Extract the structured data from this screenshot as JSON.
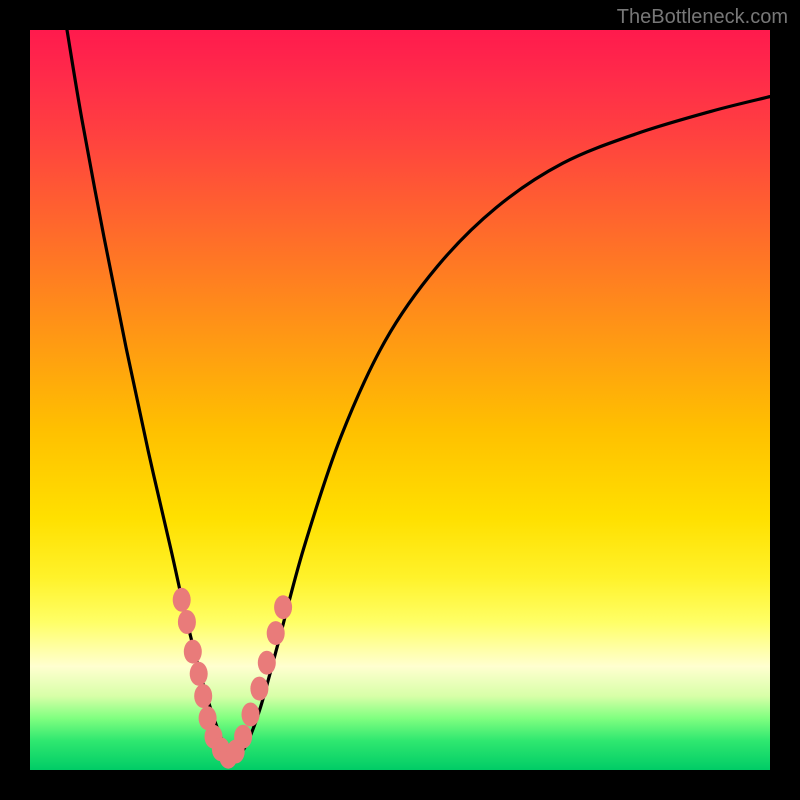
{
  "watermark": "TheBottleneck.com",
  "chart_data": {
    "type": "line",
    "title": "",
    "xlabel": "",
    "ylabel": "",
    "xlim": [
      0,
      100
    ],
    "ylim": [
      0,
      100
    ],
    "series": [
      {
        "name": "bottleneck-curve",
        "x": [
          5,
          7,
          10,
          13,
          16,
          19,
          21,
          23,
          24.5,
          26,
          27.5,
          29,
          31,
          33.5,
          37,
          42,
          48,
          55,
          63,
          72,
          82,
          92,
          100
        ],
        "y": [
          100,
          88,
          72,
          57,
          43,
          30,
          21,
          13,
          8,
          4,
          2,
          3,
          8,
          17,
          30,
          45,
          58,
          68,
          76,
          82,
          86,
          89,
          91
        ]
      }
    ],
    "markers": {
      "name": "highlighted-points",
      "color": "#e97b7a",
      "points": [
        {
          "x": 20.5,
          "y": 23
        },
        {
          "x": 21.2,
          "y": 20
        },
        {
          "x": 22.0,
          "y": 16
        },
        {
          "x": 22.8,
          "y": 13
        },
        {
          "x": 23.4,
          "y": 10
        },
        {
          "x": 24.0,
          "y": 7
        },
        {
          "x": 24.8,
          "y": 4.5
        },
        {
          "x": 25.8,
          "y": 2.8
        },
        {
          "x": 26.8,
          "y": 1.8
        },
        {
          "x": 27.8,
          "y": 2.5
        },
        {
          "x": 28.8,
          "y": 4.5
        },
        {
          "x": 29.8,
          "y": 7.5
        },
        {
          "x": 31.0,
          "y": 11
        },
        {
          "x": 32.0,
          "y": 14.5
        },
        {
          "x": 33.2,
          "y": 18.5
        },
        {
          "x": 34.2,
          "y": 22
        }
      ]
    }
  }
}
